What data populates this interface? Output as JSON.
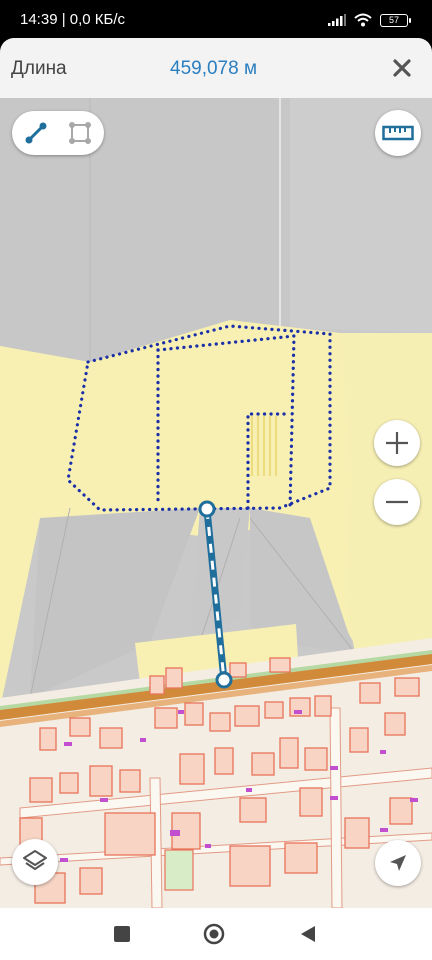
{
  "status_bar": {
    "time_speed": "14:39 | 0,0 КБ/с",
    "battery_level": "57"
  },
  "header": {
    "label": "Длина",
    "value": "459,078 м"
  },
  "icons": {
    "close": "close-icon",
    "line_tool": "line-measure-icon",
    "area_tool": "area-measure-icon",
    "ruler": "ruler-icon",
    "zoom_in": "plus-icon",
    "zoom_out": "minus-icon",
    "layers": "layers-icon",
    "locate": "navigation-arrow-icon"
  },
  "colors": {
    "accent": "#2a7fc1",
    "measure_line": "#1f6e9c",
    "boundary_dots": "#1a2fa8",
    "parcel_fill": "#f7f0b2",
    "building_outline": "#e8735a",
    "road": "#d08a3a"
  }
}
